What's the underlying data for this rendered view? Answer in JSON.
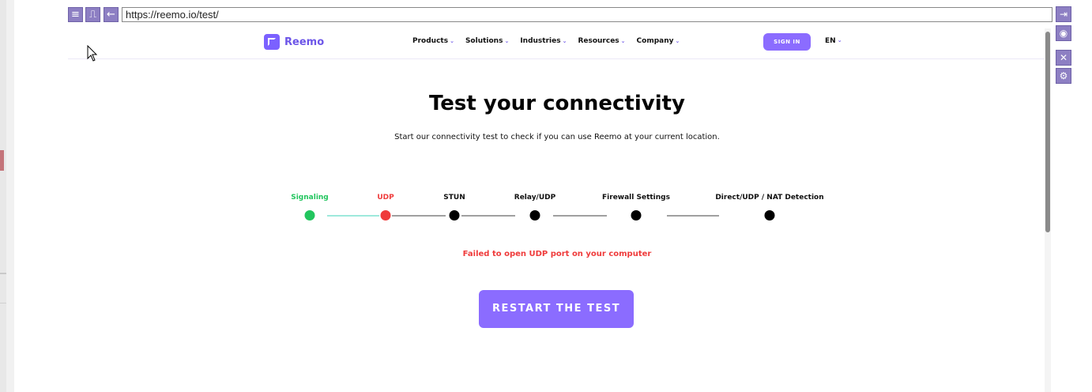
{
  "browser": {
    "url": "https://reemo.io/test/",
    "left_buttons": [
      "menu-icon",
      "pulse-icon",
      "back-arrow-icon"
    ],
    "right_buttons": [
      "login-icon",
      "wifi-icon",
      "compress-icon",
      "gear-icon"
    ]
  },
  "site": {
    "logo_text": "Reemo",
    "menu": [
      "Products",
      "Solutions",
      "Industries",
      "Resources",
      "Company"
    ],
    "signin_label": "SIGN IN",
    "language": "EN"
  },
  "page": {
    "title": "Test your connectivity",
    "subtitle": "Start our connectivity test to check if you can use Reemo at your current location.",
    "steps": [
      {
        "label": "Signaling",
        "status": "success"
      },
      {
        "label": "UDP",
        "status": "failed"
      },
      {
        "label": "STUN",
        "status": "pending"
      },
      {
        "label": "Relay/UDP",
        "status": "pending"
      },
      {
        "label": "Firewall Settings",
        "status": "pending"
      },
      {
        "label": "Direct/UDP / NAT Detection",
        "status": "pending"
      }
    ],
    "error_message": "Failed to open UDP port on your computer",
    "restart_label": "RESTART THE TEST"
  },
  "colors": {
    "accent": "#8b6cff",
    "success": "#22c55e",
    "error": "#ef3b3b",
    "pending": "#000000"
  }
}
